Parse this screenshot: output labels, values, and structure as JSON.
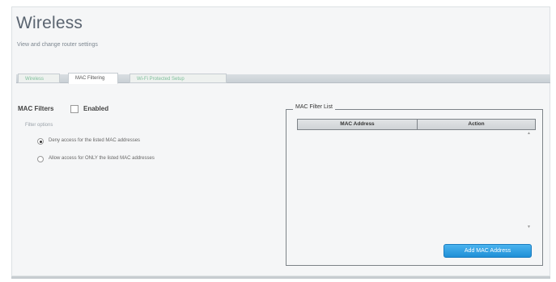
{
  "page": {
    "title": "Wireless",
    "subtitle": "View and change router settings"
  },
  "tabs": [
    {
      "label": "Wireless",
      "active": false
    },
    {
      "label": "MAC Filtering",
      "active": true
    },
    {
      "label": "Wi-Fi Protected Setup",
      "active": false
    }
  ],
  "mac_filters": {
    "label": "MAC Filters",
    "enabled_label": "Enabled",
    "enabled_checked": false,
    "filter_options_label": "Filter options",
    "options": [
      {
        "label": "Deny access for the listed MAC addresses",
        "selected": true
      },
      {
        "label": "Allow access for ONLY the listed MAC addresses",
        "selected": false
      }
    ]
  },
  "mac_filter_list": {
    "legend": "MAC Filter List",
    "columns": [
      "MAC Address",
      "Action"
    ],
    "rows": [],
    "add_button_label": "Add MAC Address"
  },
  "colors": {
    "accent": "#2a9be0",
    "inactive_tab_text": "#7dbf9a"
  }
}
